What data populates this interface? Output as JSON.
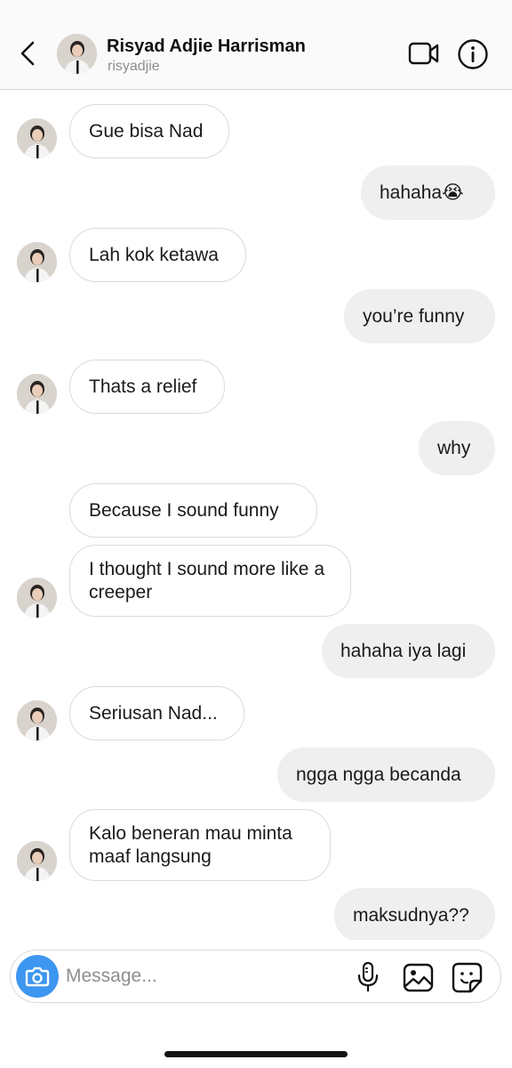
{
  "header": {
    "contact_name": "Risyad Adjie Harrisman",
    "contact_handle": "risyadjie",
    "back_icon": "chevron-left-icon",
    "video_icon": "video-camera-icon",
    "info_icon": "info-icon"
  },
  "messages": [
    {
      "side": "in",
      "text": "Gue bisa Nad",
      "avatar": true
    },
    {
      "side": "out",
      "text": "hahaha😭"
    },
    {
      "side": "in",
      "text": "Lah kok ketawa",
      "avatar": true
    },
    {
      "side": "out",
      "text": "you’re funny"
    },
    {
      "side": "in",
      "text": "Thats a relief",
      "avatar": true
    },
    {
      "side": "out",
      "text": "why"
    },
    {
      "side": "in",
      "text": "Because I sound funny",
      "avatar": false
    },
    {
      "side": "in",
      "text": "I thought I sound more like a creeper",
      "avatar": true
    },
    {
      "side": "out",
      "text": "hahaha iya lagi"
    },
    {
      "side": "in",
      "text": "Seriusan Nad...",
      "avatar": true
    },
    {
      "side": "out",
      "text": "ngga ngga becanda"
    },
    {
      "side": "in",
      "text": "Kalo beneran mau minta maaf langsung",
      "avatar": true
    },
    {
      "side": "out",
      "text": "maksudnya??"
    }
  ],
  "composer": {
    "placeholder": "Message...",
    "camera_icon": "camera-icon",
    "mic_icon": "microphone-icon",
    "gallery_icon": "image-gallery-icon",
    "sticker_icon": "sticker-icon"
  },
  "colors": {
    "camera_button": "#3d96f0",
    "outgoing_bubble": "#efefef",
    "incoming_border": "#dbdbdb",
    "secondary_text": "#8e8e8e"
  }
}
